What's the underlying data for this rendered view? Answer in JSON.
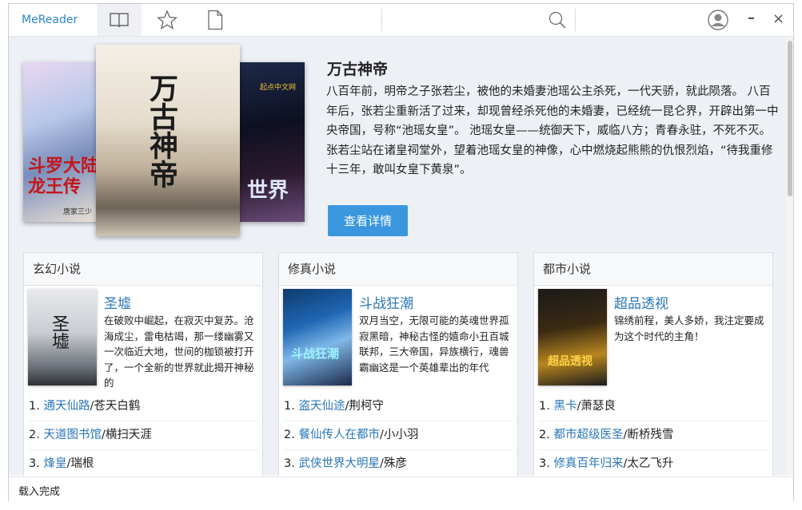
{
  "app": {
    "name": "MeReader"
  },
  "toolbar": {
    "icons": [
      "book-icon",
      "star-icon",
      "document-icon"
    ],
    "search_icon": "search-icon",
    "user_icon": "user-avatar-icon",
    "minimize": "–",
    "close": "×"
  },
  "featured": {
    "title": "万古神帝",
    "description": "八百年前，明帝之子张若尘，被他的未婚妻池瑶公主杀死，一代天骄，就此陨落。 八百年后，张若尘重新活了过来，却现曾经杀死他的未婚妻，已经统一昆仑界，开辟出第一中央帝国，号称“池瑶女皇”。 池瑶女皇——统御天下，威临八方；青春永驻，不死不灭。 张若尘站在诸皇祠堂外，望着池瑶女皇的神像，心中燃烧起熊熊的仇恨烈焰，“待我重修十三年，敢叫女皇下黄泉”。",
    "button": "查看详情",
    "cover_main_text": "万古神帝",
    "cover_left_text": "斗罗大陆 龙王传",
    "cover_left_sub": "唐家三少",
    "cover_right_text": "世界",
    "cover_right_badge": "起点中文网"
  },
  "panels": [
    {
      "header": "玄幻小说",
      "book_title": "圣墟",
      "cover_text": "圣墟",
      "book_desc": "在破败中崛起，在寂灭中复苏。沧海成尘，雷电枯竭，那一缕幽雾又一次临近大地，世间的枷锁被打开了，一个全新的世界就此揭开神秘的",
      "ranks": [
        {
          "num": "1.",
          "book": "通天仙路",
          "author": "/苍天白鹤"
        },
        {
          "num": "2.",
          "book": "天道图书馆",
          "author": "/横扫天涯"
        },
        {
          "num": "3.",
          "book": "烽皇",
          "author": "/瑞根"
        }
      ]
    },
    {
      "header": "修真小说",
      "book_title": "斗战狂潮",
      "cover_text": "斗战狂潮",
      "book_desc": "双月当空，无限可能的英魂世界孤寂黑暗，神秘古怪的嬉命小丑百城联邦，三大帝国，异族横行，魂兽霸幽这是一个英雄辈出的年代",
      "ranks": [
        {
          "num": "1.",
          "book": "盗天仙途",
          "author": "/荆柯守"
        },
        {
          "num": "2.",
          "book": "餐仙传人在都市",
          "author": "/小小羽"
        },
        {
          "num": "3.",
          "book": "武侠世界大明星",
          "author": "/殊彦"
        }
      ]
    },
    {
      "header": "都市小说",
      "book_title": "超品透视",
      "cover_text": "超品透视",
      "book_desc": "锦绣前程，美人多娇，我注定要成为这个时代的主角！",
      "ranks": [
        {
          "num": "1.",
          "book": "黑卡",
          "author": "/萧瑟良"
        },
        {
          "num": "2.",
          "book": "都市超级医圣",
          "author": "/断桥残雪"
        },
        {
          "num": "3.",
          "book": "修真百年归来",
          "author": "/太乙飞升"
        }
      ]
    }
  ],
  "status": {
    "text": "载入完成"
  }
}
